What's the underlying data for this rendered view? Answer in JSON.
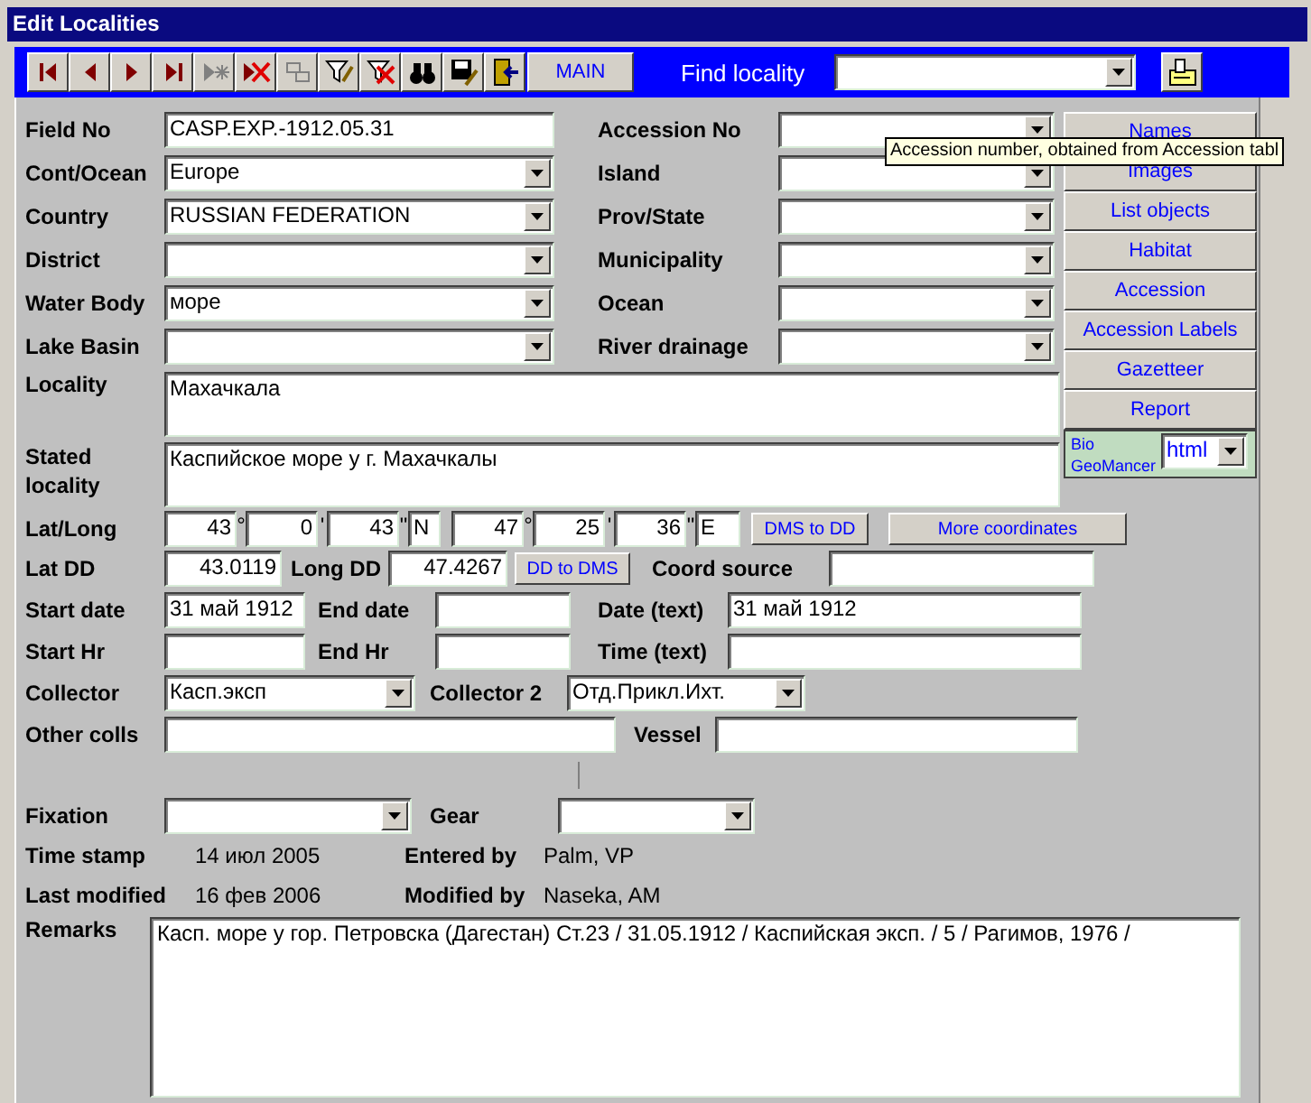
{
  "window": {
    "title": "Edit Localities"
  },
  "toolbar": {
    "buttons": [
      {
        "kind": "first",
        "disabled": false
      },
      {
        "kind": "prev",
        "disabled": false
      },
      {
        "kind": "next",
        "disabled": false
      },
      {
        "kind": "last",
        "disabled": false
      },
      {
        "kind": "new",
        "disabled": true
      },
      {
        "kind": "delete",
        "disabled": false
      },
      {
        "kind": "copy",
        "disabled": true
      },
      {
        "kind": "filter_edit",
        "disabled": false
      },
      {
        "kind": "filter_remove",
        "disabled": false
      },
      {
        "kind": "find",
        "disabled": false
      },
      {
        "kind": "save",
        "disabled": false
      },
      {
        "kind": "exit",
        "disabled": false
      }
    ],
    "main_button": "MAIN",
    "find_label": "Find locality"
  },
  "tooltip": "Accession number, obtained from Accession tabl",
  "fields": {
    "field_no": {
      "label": "Field No",
      "kind": "text",
      "value": "CASP.EXP.-1912.05.31"
    },
    "accession_no": {
      "label": "Accession No",
      "kind": "combo"
    },
    "cont_ocean": {
      "label": "Cont/Ocean",
      "kind": "combo",
      "value": "Europe"
    },
    "island": {
      "label": "Island",
      "kind": "combo"
    },
    "country": {
      "label": "Country",
      "kind": "combo",
      "value": "RUSSIAN FEDERATION"
    },
    "prov_state": {
      "label": "Prov/State",
      "kind": "combo"
    },
    "district": {
      "label": "District",
      "kind": "combo"
    },
    "municipality": {
      "label": "Municipality",
      "kind": "combo"
    },
    "water_body": {
      "label": "Water Body",
      "kind": "combo",
      "value": "море"
    },
    "ocean": {
      "label": "Ocean",
      "kind": "combo"
    },
    "lake_basin": {
      "label": "Lake Basin",
      "kind": "combo"
    },
    "river_drainage": {
      "label": "River drainage",
      "kind": "combo"
    },
    "locality": {
      "label": "Locality",
      "kind": "memo",
      "value": "Махачкала"
    },
    "stated_locality": {
      "label": "Stated locality",
      "kind": "memo",
      "value": "Каспийское море у г. Махачкалы"
    },
    "lat_dd": {
      "label": "Lat DD",
      "kind": "number",
      "value": "43.0119"
    },
    "long_dd": {
      "label": "Long DD",
      "kind": "number",
      "value": "47.4267"
    },
    "coord_source": {
      "label": "Coord source",
      "kind": "text"
    },
    "start_date": {
      "label": "Start date",
      "kind": "text",
      "value": "31 май 1912"
    },
    "end_date": {
      "label": "End date",
      "kind": "text"
    },
    "date_text": {
      "label": "Date (text)",
      "kind": "text",
      "value": "31 май 1912"
    },
    "start_hr": {
      "label": "Start Hr",
      "kind": "text"
    },
    "end_hr": {
      "label": "End Hr",
      "kind": "text"
    },
    "time_text": {
      "label": "Time (text)",
      "kind": "text"
    },
    "collector": {
      "label": "Collector",
      "kind": "combo",
      "value": "Касп.эксп"
    },
    "collector_2": {
      "label": "Collector 2",
      "kind": "combo",
      "value": "Отд.Прикл.Ихт."
    },
    "other_colls": {
      "label": "Other colls",
      "kind": "text"
    },
    "vessel": {
      "label": "Vessel",
      "kind": "text"
    },
    "fixation": {
      "label": "Fixation",
      "kind": "combo"
    },
    "gear": {
      "label": "Gear",
      "kind": "combo"
    }
  },
  "lat_long": {
    "label": "Lat/Long",
    "parts": [
      {
        "kind": "number",
        "value": "43",
        "unit": "°"
      },
      {
        "kind": "number",
        "value": "0",
        "unit": "'"
      },
      {
        "kind": "number",
        "value": "43",
        "unit": "\""
      },
      {
        "kind": "hemisphere",
        "value": "N"
      },
      {
        "kind": "number",
        "value": "47",
        "unit": "°"
      },
      {
        "kind": "number",
        "value": "25",
        "unit": "'"
      },
      {
        "kind": "number",
        "value": "36",
        "unit": "\""
      },
      {
        "kind": "hemisphere",
        "value": "E"
      }
    ],
    "buttons": [
      "DMS to DD",
      "More coordinates"
    ]
  },
  "dd_button": "DD to DMS",
  "info": [
    [
      {
        "label": "Time stamp",
        "value": "14 июл 2005"
      },
      {
        "label": "Entered by",
        "value": "Palm, VP"
      }
    ],
    [
      {
        "label": "Last modified",
        "value": "16 фев 2006"
      },
      {
        "label": "Modified by",
        "value": "Naseka, AM"
      }
    ]
  ],
  "remarks": {
    "label": "Remarks",
    "value": "Касп. море у гор. Петровска (Дагестан) Ст.23  / 31.05.1912 / Каспийская эксп. / 5 / Рагимов, 1976 /"
  },
  "side_buttons": [
    "Names",
    "Images",
    "List objects",
    "Habitat",
    "Accession",
    "Accession Labels",
    "Gazetteer",
    "Report"
  ],
  "geomancer": {
    "label": "Bio GeoMancer",
    "value": "html"
  }
}
